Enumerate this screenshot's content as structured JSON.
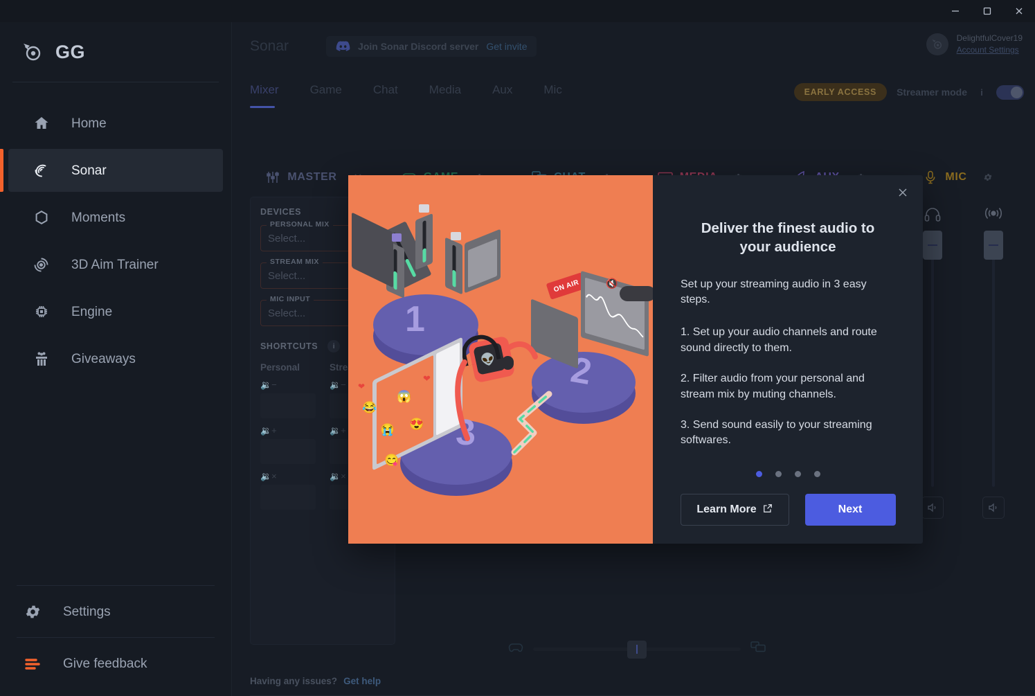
{
  "window": {
    "controls": [
      {
        "name": "minimize",
        "label": "—"
      },
      {
        "name": "maximize",
        "label": "□"
      },
      {
        "name": "close",
        "label": "✕"
      }
    ]
  },
  "sidebar": {
    "brand": {
      "logo": "steelseries-logo-icon",
      "text": "GG"
    },
    "items": [
      {
        "label": "Home",
        "icon": "home-icon",
        "active": false
      },
      {
        "label": "Sonar",
        "icon": "sonar-icon",
        "active": true
      },
      {
        "label": "Moments",
        "icon": "moments-hexagon-icon",
        "active": false
      },
      {
        "label": "3D Aim Trainer",
        "icon": "aim-trainer-icon",
        "active": false
      },
      {
        "label": "Engine",
        "icon": "engine-chip-icon",
        "active": false
      },
      {
        "label": "Giveaways",
        "icon": "gift-icon",
        "active": false
      }
    ],
    "bottom": [
      {
        "label": "Settings",
        "icon": "gear-icon"
      },
      {
        "label": "Give feedback",
        "icon": "feedback-lines-icon"
      }
    ]
  },
  "header": {
    "title": "Sonar",
    "discord": {
      "icon": "discord-icon",
      "text": "Join Sonar Discord server",
      "link": "Get invite"
    },
    "account": {
      "avatar": "steelseries-avatar-icon",
      "name": "DelightfulCover19",
      "link": "Account Settings"
    }
  },
  "tabs": [
    {
      "label": "Mixer",
      "active": true
    },
    {
      "label": "Game",
      "active": false
    },
    {
      "label": "Chat",
      "active": false
    },
    {
      "label": "Media",
      "active": false
    },
    {
      "label": "Aux",
      "active": false
    },
    {
      "label": "Mic",
      "active": false
    }
  ],
  "tabs_right": {
    "badge": "EARLY ACCESS",
    "streamer_label": "Streamer mode",
    "info": "i",
    "toggle_state": "on"
  },
  "mixer": {
    "channels": [
      {
        "name": "MASTER",
        "icon": "sliders-icon",
        "action": "close-icon",
        "color": "#4a5270"
      },
      {
        "name": "GAME",
        "icon": "gamepad-icon",
        "action": "gear-icon",
        "color": "#1f6b4e"
      },
      {
        "name": "CHAT",
        "icon": "chat-bubbles-icon",
        "action": "gear-icon",
        "color": "#2f6376"
      },
      {
        "name": "MEDIA",
        "icon": "media-play-icon",
        "action": "gear-icon",
        "color": "#8c3550"
      },
      {
        "name": "AUX",
        "icon": "aux-feather-icon",
        "action": "gear-icon",
        "color": "#5a4e9c"
      },
      {
        "name": "MIC",
        "icon": "microphone-icon",
        "action": "gear-icon",
        "color": "#8a6b1f"
      }
    ],
    "devices": {
      "title": "DEVICES",
      "fields": [
        {
          "legend": "PERSONAL MIX",
          "value": "Select...",
          "warning": "warning-icon"
        },
        {
          "legend": "STREAM MIX",
          "value": "Select...",
          "warning": "warning-icon"
        },
        {
          "legend": "MIC INPUT",
          "value": "Select...",
          "warning": "warning-icon"
        }
      ]
    },
    "shortcuts": {
      "title": "SHORTCUTS",
      "info": "i",
      "columns": [
        {
          "title": "Personal",
          "rows": [
            {
              "icon": "volume-down-icon",
              "value": ""
            },
            {
              "icon": "volume-up-icon",
              "value": ""
            },
            {
              "icon": "volume-mute-icon",
              "value": ""
            }
          ]
        },
        {
          "title": "Stream",
          "rows": [
            {
              "icon": "volume-down-icon",
              "value": ""
            },
            {
              "icon": "volume-up-icon",
              "value": ""
            },
            {
              "icon": "volume-mute-icon",
              "value": ""
            }
          ]
        }
      ]
    },
    "mic_controls": {
      "icons": [
        "headphones-icon",
        "broadcast-icon"
      ],
      "mute_buttons": [
        "speaker-icon",
        "speaker-icon"
      ]
    },
    "bottom_balance": {
      "left_icon": "gamepad-icon",
      "right_icon": "chat-bubbles-icon",
      "value": "1"
    },
    "footer": {
      "question": "Having any issues?",
      "link": "Get help"
    }
  },
  "modal": {
    "close": "close-icon",
    "title": "Deliver the finest audio to your audience",
    "lead": "Set up your streaming audio in 3 easy steps.",
    "steps": [
      "1. Set up your audio channels and route sound directly to them.",
      "2. Filter audio from your personal and stream mix by muting channels.",
      "3. Send sound easily to your streaming softwares."
    ],
    "dots": {
      "count": 4,
      "active_index": 0
    },
    "learn_more": "Learn More",
    "learn_more_icon": "external-link-icon",
    "next": "Next",
    "illustration": {
      "background": "#ef7e52",
      "onair_label": "ON AIR",
      "disc_numbers": [
        "1",
        "2",
        "3"
      ],
      "emojis": [
        "😂",
        "😱",
        "😭",
        "😍",
        "😋",
        "❤",
        "❤"
      ]
    }
  },
  "colors": {
    "accent_orange": "#f4622c",
    "accent_blue": "#4c5ce0",
    "sidebar_bg": "#161b23",
    "panel_bg": "#1a1f29",
    "modal_bg": "#1d232d",
    "illustration_bg": "#ef7e52"
  }
}
